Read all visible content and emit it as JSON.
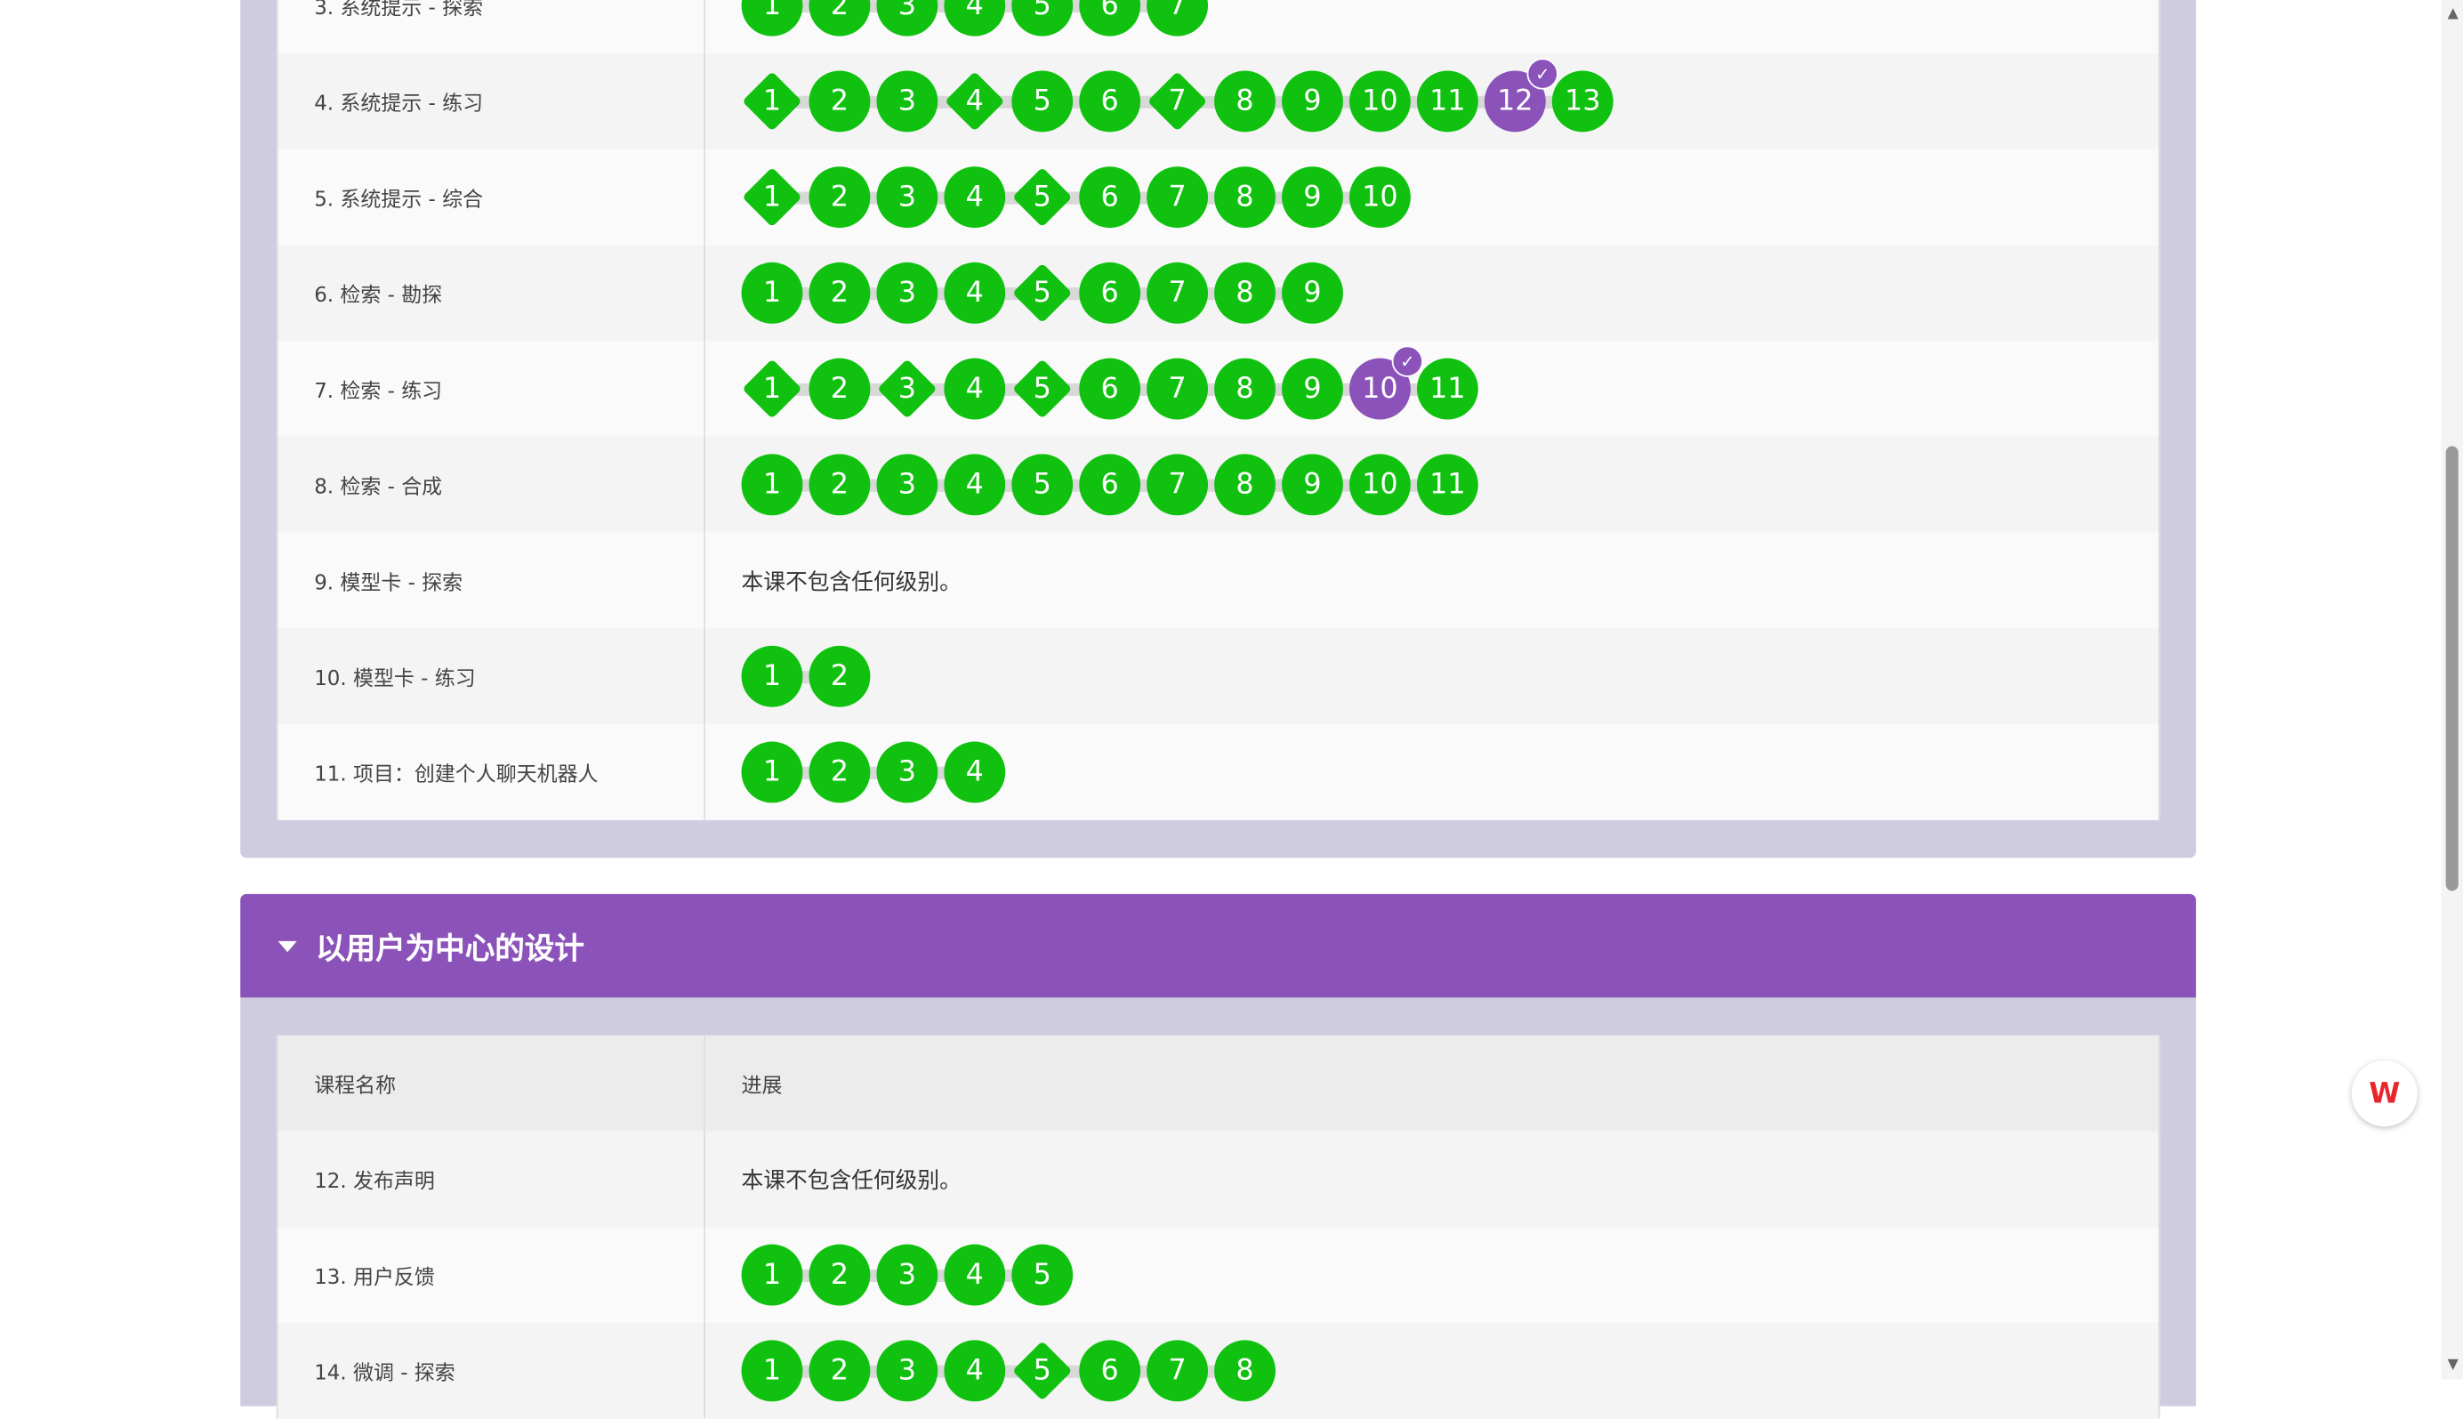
{
  "empty_text": "本课不包含任何级别。",
  "header_cols": {
    "name": "课程名称",
    "progress": "进展"
  },
  "section2_title": "以用户为中心的设计",
  "wps_label": "W",
  "colors": {
    "accent": "#8b53b9",
    "level_green": "#10c20f",
    "panel": "#cfcbe0"
  },
  "section1_rows": [
    {
      "name": "3. 系统提示 - 探索",
      "levels": [
        {
          "n": "1",
          "shape": "circle"
        },
        {
          "n": "2",
          "shape": "circle"
        },
        {
          "n": "3",
          "shape": "circle"
        },
        {
          "n": "4",
          "shape": "circle"
        },
        {
          "n": "5",
          "shape": "circle"
        },
        {
          "n": "6",
          "shape": "circle"
        },
        {
          "n": "7",
          "shape": "circle"
        }
      ]
    },
    {
      "name": "4. 系统提示 - 练习",
      "levels": [
        {
          "n": "1",
          "shape": "diamond"
        },
        {
          "n": "2",
          "shape": "circle"
        },
        {
          "n": "3",
          "shape": "circle"
        },
        {
          "n": "4",
          "shape": "diamond"
        },
        {
          "n": "5",
          "shape": "circle"
        },
        {
          "n": "6",
          "shape": "circle"
        },
        {
          "n": "7",
          "shape": "diamond"
        },
        {
          "n": "8",
          "shape": "circle"
        },
        {
          "n": "9",
          "shape": "circle"
        },
        {
          "n": "10",
          "shape": "circle"
        },
        {
          "n": "11",
          "shape": "circle"
        },
        {
          "n": "12",
          "shape": "circle",
          "current": true
        },
        {
          "n": "13",
          "shape": "circle"
        }
      ]
    },
    {
      "name": "5. 系统提示 - 综合",
      "levels": [
        {
          "n": "1",
          "shape": "diamond"
        },
        {
          "n": "2",
          "shape": "circle"
        },
        {
          "n": "3",
          "shape": "circle"
        },
        {
          "n": "4",
          "shape": "circle"
        },
        {
          "n": "5",
          "shape": "diamond"
        },
        {
          "n": "6",
          "shape": "circle"
        },
        {
          "n": "7",
          "shape": "circle"
        },
        {
          "n": "8",
          "shape": "circle"
        },
        {
          "n": "9",
          "shape": "circle"
        },
        {
          "n": "10",
          "shape": "circle"
        }
      ]
    },
    {
      "name": "6. 检索 - 勘探",
      "levels": [
        {
          "n": "1",
          "shape": "circle"
        },
        {
          "n": "2",
          "shape": "circle"
        },
        {
          "n": "3",
          "shape": "circle"
        },
        {
          "n": "4",
          "shape": "circle"
        },
        {
          "n": "5",
          "shape": "diamond"
        },
        {
          "n": "6",
          "shape": "circle"
        },
        {
          "n": "7",
          "shape": "circle"
        },
        {
          "n": "8",
          "shape": "circle"
        },
        {
          "n": "9",
          "shape": "circle"
        }
      ]
    },
    {
      "name": "7. 检索 - 练习",
      "levels": [
        {
          "n": "1",
          "shape": "diamond"
        },
        {
          "n": "2",
          "shape": "circle"
        },
        {
          "n": "3",
          "shape": "diamond"
        },
        {
          "n": "4",
          "shape": "circle"
        },
        {
          "n": "5",
          "shape": "diamond"
        },
        {
          "n": "6",
          "shape": "circle"
        },
        {
          "n": "7",
          "shape": "circle"
        },
        {
          "n": "8",
          "shape": "circle"
        },
        {
          "n": "9",
          "shape": "circle"
        },
        {
          "n": "10",
          "shape": "circle",
          "current": true
        },
        {
          "n": "11",
          "shape": "circle"
        }
      ]
    },
    {
      "name": "8. 检索 - 合成",
      "levels": [
        {
          "n": "1",
          "shape": "circle"
        },
        {
          "n": "2",
          "shape": "circle"
        },
        {
          "n": "3",
          "shape": "circle"
        },
        {
          "n": "4",
          "shape": "circle"
        },
        {
          "n": "5",
          "shape": "circle"
        },
        {
          "n": "6",
          "shape": "circle"
        },
        {
          "n": "7",
          "shape": "circle"
        },
        {
          "n": "8",
          "shape": "circle"
        },
        {
          "n": "9",
          "shape": "circle"
        },
        {
          "n": "10",
          "shape": "circle"
        },
        {
          "n": "11",
          "shape": "circle"
        }
      ]
    },
    {
      "name": "9. 模型卡 - 探索",
      "levels": []
    },
    {
      "name": "10. 模型卡 - 练习",
      "levels": [
        {
          "n": "1",
          "shape": "circle"
        },
        {
          "n": "2",
          "shape": "circle"
        }
      ]
    },
    {
      "name": "11. 项目：创建个人聊天机器人",
      "levels": [
        {
          "n": "1",
          "shape": "circle"
        },
        {
          "n": "2",
          "shape": "circle"
        },
        {
          "n": "3",
          "shape": "circle"
        },
        {
          "n": "4",
          "shape": "circle"
        }
      ]
    }
  ],
  "section2_rows": [
    {
      "name": "12. 发布声明",
      "levels": []
    },
    {
      "name": "13. 用户反馈",
      "levels": [
        {
          "n": "1",
          "shape": "circle"
        },
        {
          "n": "2",
          "shape": "circle"
        },
        {
          "n": "3",
          "shape": "circle"
        },
        {
          "n": "4",
          "shape": "circle"
        },
        {
          "n": "5",
          "shape": "circle"
        }
      ]
    },
    {
      "name": "14. 微调 - 探索",
      "levels": [
        {
          "n": "1",
          "shape": "circle"
        },
        {
          "n": "2",
          "shape": "circle"
        },
        {
          "n": "3",
          "shape": "circle"
        },
        {
          "n": "4",
          "shape": "circle"
        },
        {
          "n": "5",
          "shape": "diamond"
        },
        {
          "n": "6",
          "shape": "circle"
        },
        {
          "n": "7",
          "shape": "circle"
        },
        {
          "n": "8",
          "shape": "circle"
        }
      ]
    }
  ]
}
